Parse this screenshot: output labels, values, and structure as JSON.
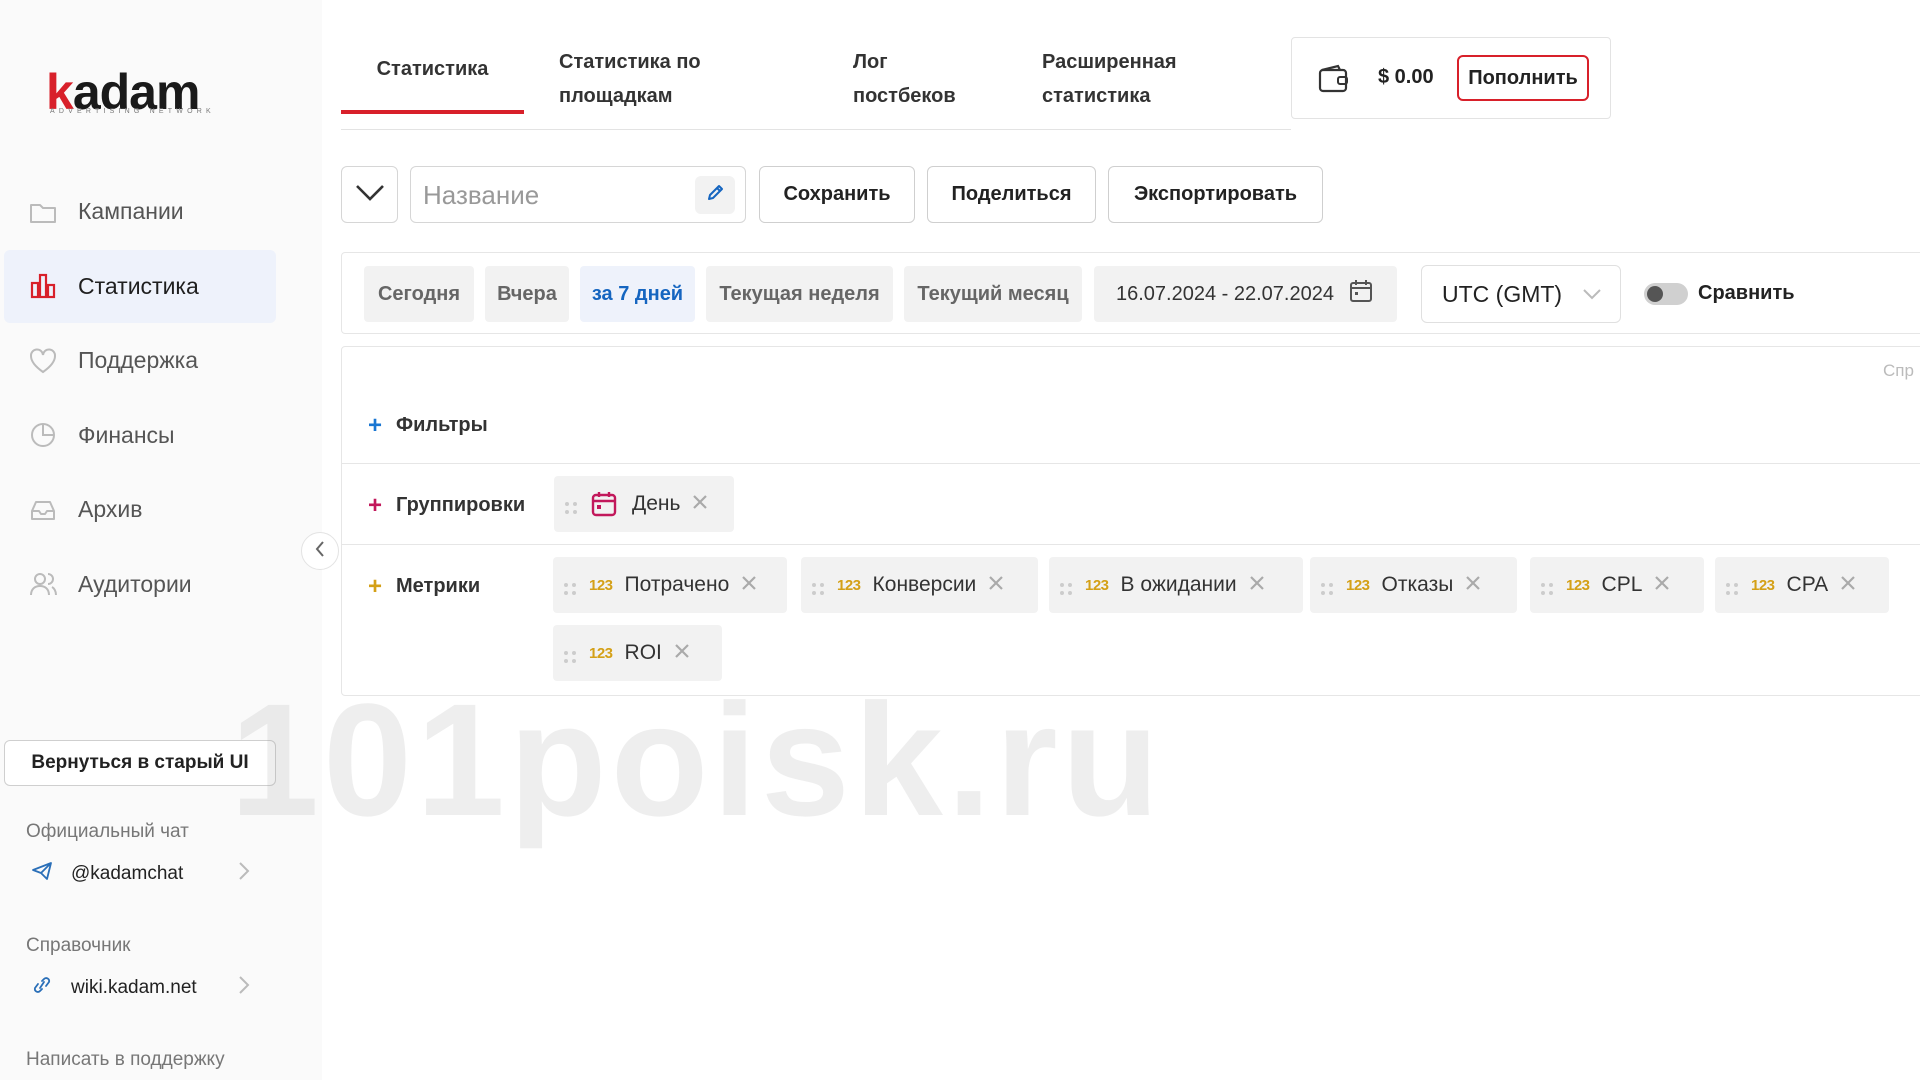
{
  "logo": {
    "word_k": "k",
    "word_rest": "adam",
    "subtitle": "ADVERTISING NETWORK"
  },
  "sidebar": {
    "items": [
      {
        "label": "Кампании",
        "icon": "folder-icon",
        "active": false
      },
      {
        "label": "Статистика",
        "icon": "bar-chart-icon",
        "active": true
      },
      {
        "label": "Поддержка",
        "icon": "heart-icon",
        "active": false
      },
      {
        "label": "Финансы",
        "icon": "pie-chart-icon",
        "active": false
      },
      {
        "label": "Архив",
        "icon": "inbox-icon",
        "active": false
      },
      {
        "label": "Аудитории",
        "icon": "users-icon",
        "active": false
      }
    ],
    "old_ui_label": "Вернуться в старый UI",
    "chat_title": "Официальный чат",
    "chat_link": "@kadamchat",
    "wiki_title": "Справочник",
    "wiki_link": "wiki.kadam.net",
    "support_text": "Написать в поддержку"
  },
  "tabs": [
    {
      "label": "Статистика",
      "active": true
    },
    {
      "label": "Статистика по площадкам",
      "active": false
    },
    {
      "label": "Лог постбеков",
      "active": false
    },
    {
      "label": "Расширенная статистика",
      "active": false
    }
  ],
  "balance": {
    "amount": "$ 0.00",
    "topup_label": "Пополнить"
  },
  "toolbar": {
    "name_placeholder": "Название",
    "save_label": "Сохранить",
    "share_label": "Поделиться",
    "export_label": "Экспортировать"
  },
  "dates": {
    "presets": [
      {
        "label": "Сегодня",
        "active": false
      },
      {
        "label": "Вчера",
        "active": false
      },
      {
        "label": "за 7 дней",
        "active": true
      },
      {
        "label": "Текущая неделя",
        "active": false
      },
      {
        "label": "Текущий месяц",
        "active": false
      }
    ],
    "range": "16.07.2024 - 22.07.2024",
    "timezone": "UTC (GMT)",
    "compare_label": "Сравнить",
    "compare_on": false
  },
  "config": {
    "help_text": "Спр",
    "filters_label": "Фильтры",
    "groupings_label": "Группировки",
    "grouping_chips": [
      {
        "label": "День",
        "icon": "calendar-icon"
      }
    ],
    "metrics_label": "Метрики",
    "metric_badge": "123",
    "metric_chips": [
      "Потрачено",
      "Конверсии",
      "В ожидании",
      "Отказы",
      "CPL",
      "CPA",
      "ROI"
    ]
  },
  "watermark": "101poisk.ru",
  "colors": {
    "brand_red": "#d8202a",
    "accent_blue": "#1565c0",
    "grouping_pink": "#c2185b",
    "metric_gold": "#d4a017",
    "plus_blue": "#1976d2"
  }
}
